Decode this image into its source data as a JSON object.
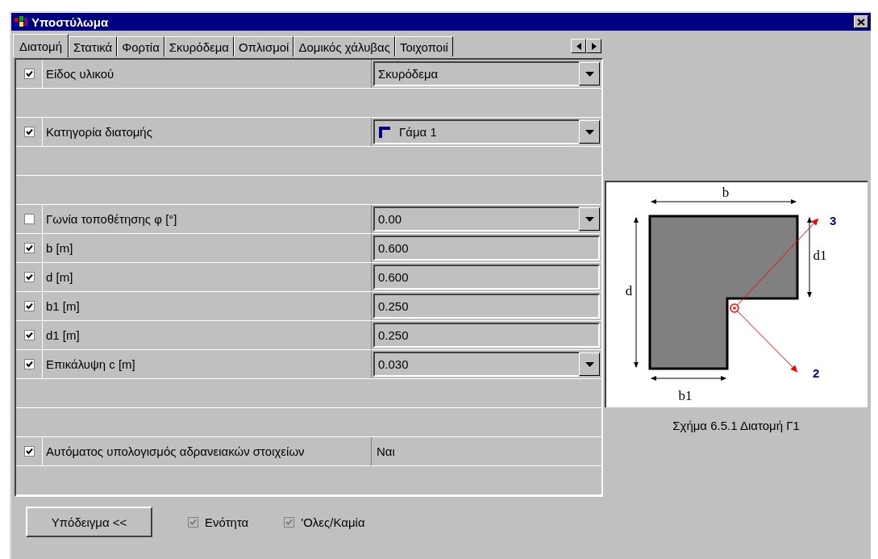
{
  "window": {
    "title": "Υποστύλωμα"
  },
  "tabs": [
    {
      "label": "Διατομή",
      "selected": true
    },
    {
      "label": "Στατικά",
      "selected": false
    },
    {
      "label": "Φορτία",
      "selected": false
    },
    {
      "label": "Σκυρόδεμα",
      "selected": false
    },
    {
      "label": "Οπλισμοί",
      "selected": false
    },
    {
      "label": "Δομικός χάλυβας",
      "selected": false
    },
    {
      "label": "Τοιχοποιί",
      "selected": false
    }
  ],
  "properties": [
    {
      "kind": "dropdown",
      "checked": true,
      "label": "Είδος υλικού",
      "value": "Σκυρόδεμα"
    },
    {
      "kind": "blank"
    },
    {
      "kind": "shape-dropdown",
      "checked": true,
      "label": "Κατηγορία διατομής",
      "value": "Γάμα 1"
    },
    {
      "kind": "blank"
    },
    {
      "kind": "blank"
    },
    {
      "kind": "dropdown",
      "checked": false,
      "label": "Γωνία τοποθέτησης φ [°]",
      "value": "0.00"
    },
    {
      "kind": "input",
      "checked": true,
      "label": "b [m]",
      "value": "0.600"
    },
    {
      "kind": "input",
      "checked": true,
      "label": "d [m]",
      "value": "0.600"
    },
    {
      "kind": "input",
      "checked": true,
      "label": "b1 [m]",
      "value": "0.250"
    },
    {
      "kind": "input",
      "checked": true,
      "label": "d1 [m]",
      "value": "0.250"
    },
    {
      "kind": "dropdown",
      "checked": true,
      "label": "Επικάλυψη c [m]",
      "value": "0.030"
    },
    {
      "kind": "blank"
    },
    {
      "kind": "blank"
    },
    {
      "kind": "text",
      "checked": true,
      "label": "Αυτόματος υπολογισμός αδρανειακών στοιχείων",
      "value": "Ναι"
    },
    {
      "kind": "blank"
    }
  ],
  "figure": {
    "labels": {
      "b": "b",
      "d": "d",
      "b1": "b1",
      "d1": "d1",
      "axis3": "3",
      "axis2": "2"
    },
    "caption": "Σχήμα 6.5.1 Διατομή Γ1"
  },
  "footer": {
    "button": "Υπόδειγμα <<",
    "checkboxes": [
      {
        "label": "Ενότητα",
        "checked": true,
        "disabled": true
      },
      {
        "label": "'Ολες/Καμία",
        "checked": true,
        "disabled": true
      }
    ]
  }
}
